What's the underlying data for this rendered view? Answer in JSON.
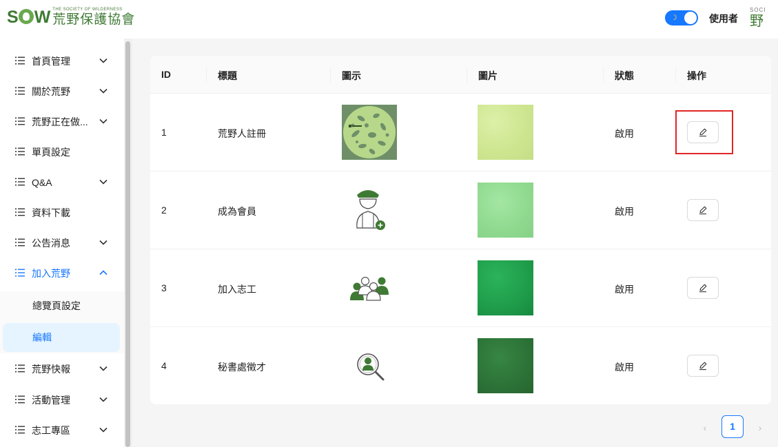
{
  "header": {
    "logo_mark_s": "S",
    "logo_mark_w": "W",
    "logo_en": "THE SOCIETY OF WILDERNESS",
    "logo_zh": "荒野保護協會",
    "user_label": "使用者",
    "avatar_small": "SOCI",
    "avatar_big": "野"
  },
  "sidebar": {
    "items": [
      {
        "label": "首頁管理",
        "expanded": false
      },
      {
        "label": "關於荒野",
        "expanded": false
      },
      {
        "label": "荒野正在做...",
        "expanded": false
      },
      {
        "label": "單頁設定"
      },
      {
        "label": "Q&A",
        "expanded": false
      },
      {
        "label": "資料下載"
      },
      {
        "label": "公告消息",
        "expanded": false
      },
      {
        "label": "加入荒野",
        "expanded": true,
        "active": true
      },
      {
        "label": "荒野快報",
        "expanded": false
      },
      {
        "label": "活動管理",
        "expanded": false
      },
      {
        "label": "志工專區",
        "expanded": false
      }
    ],
    "sub_items": [
      {
        "label": "總覽頁設定"
      },
      {
        "label": "編輯",
        "selected": true
      }
    ]
  },
  "table": {
    "columns": [
      "ID",
      "標題",
      "圖示",
      "圖片",
      "狀態",
      "操作"
    ],
    "rows": [
      {
        "id": "1",
        "title": "荒野人註冊",
        "icon": "wildlife-collage-icon",
        "picture_color": "#d4eb9a",
        "status": "啟用"
      },
      {
        "id": "2",
        "title": "成為會員",
        "icon": "member-add-icon",
        "picture_color": "#93dd93",
        "status": "啟用"
      },
      {
        "id": "3",
        "title": "加入志工",
        "icon": "volunteer-group-icon",
        "picture_color": "#1f9c4a",
        "status": "啟用"
      },
      {
        "id": "4",
        "title": "秘書處徵才",
        "icon": "recruit-search-icon",
        "picture_color": "#2c7237",
        "status": "啟用"
      }
    ]
  },
  "pagination": {
    "prev": "‹",
    "current": "1",
    "next": "›"
  },
  "colors": {
    "accent": "#1677ff",
    "brand_green": "#3f7a34",
    "highlight": "#e02424"
  }
}
